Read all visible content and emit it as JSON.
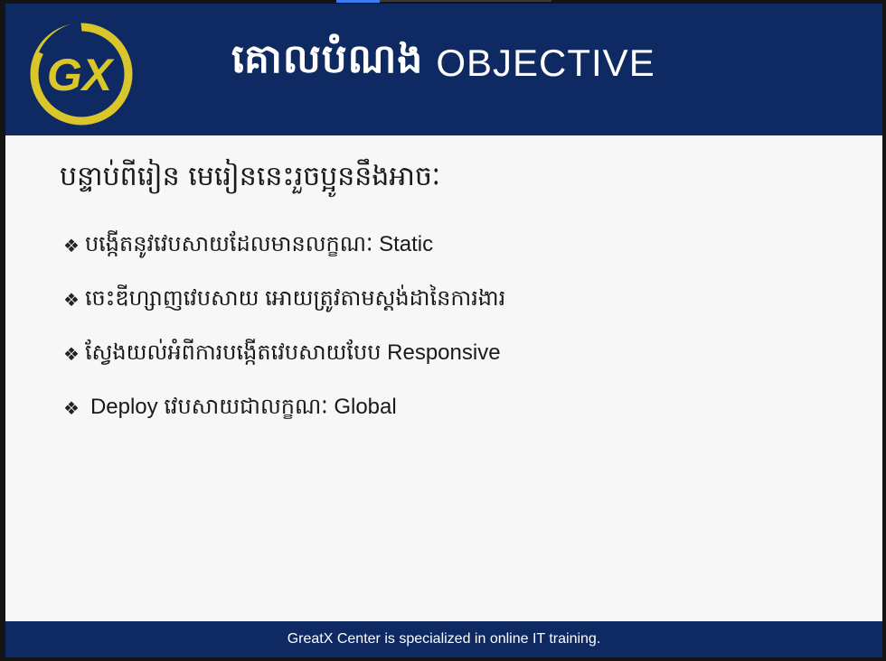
{
  "header": {
    "title_khmer": "គោលបំណង",
    "title_english": "OBJECTIVE",
    "logo": {
      "text": "GX",
      "icon": "gx-logo-icon",
      "ring_color": "#d8c62a",
      "letter_color": "#d8c62a"
    }
  },
  "content": {
    "intro": "បន្ទាប់ពីរៀន មេរៀននេះរួចប្អូននឹងអាចៈ",
    "bullets": [
      {
        "glyph": "❖",
        "text": "បង្កើតនូវវេបសាយដែលមានលក្ខណៈ Static"
      },
      {
        "glyph": "❖",
        "text": "ចេះឌីហ្សាញវេបសាយ អោយត្រូវតាមស្តង់ដានៃការងារ"
      },
      {
        "glyph": "❖",
        "text": "ស្វែងយល់អំពីការបង្កើតវេបសាយបែប Responsive"
      },
      {
        "glyph": "❖",
        "text": "Deploy វេបសាយជាលក្ខណៈ Global"
      }
    ]
  },
  "footer": {
    "text": "GreatX Center is specialized in online IT training."
  },
  "colors": {
    "header_bg": "#0f2a63",
    "footer_bg": "#0f2a63",
    "accent": "#d8c62a",
    "text": "#1a1a1a"
  }
}
